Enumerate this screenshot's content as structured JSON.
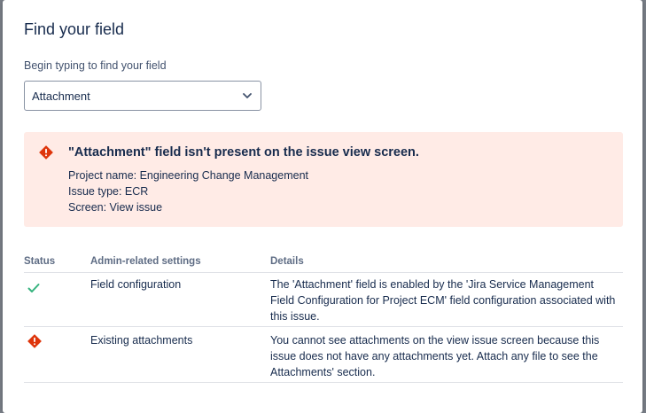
{
  "modal": {
    "title": "Find your field",
    "field_label": "Begin typing to find your field",
    "select_value": "Attachment"
  },
  "alert": {
    "icon": "error-icon",
    "heading": "\"Attachment\" field isn't present on the issue view screen.",
    "lines": [
      "Project name: Engineering Change Management",
      "Issue type: ECR",
      "Screen: View issue"
    ]
  },
  "table": {
    "headers": [
      "Status",
      "Admin-related settings",
      "Details"
    ],
    "rows": [
      {
        "status_icon": "check-icon",
        "setting": "Field configuration",
        "details": "The 'Attachment' field is enabled by the 'Jira Service Management Field Configuration for Project ECM' field configuration associated with this issue."
      },
      {
        "status_icon": "error-icon",
        "setting": "Existing attachments",
        "details": "You cannot see attachments on the view issue screen because this issue does not have any attachments yet. Attach any file to see the Attachments' section."
      }
    ]
  },
  "colors": {
    "error": "#de350b",
    "success": "#36b37e",
    "alert_bg": "#ffebe6"
  }
}
